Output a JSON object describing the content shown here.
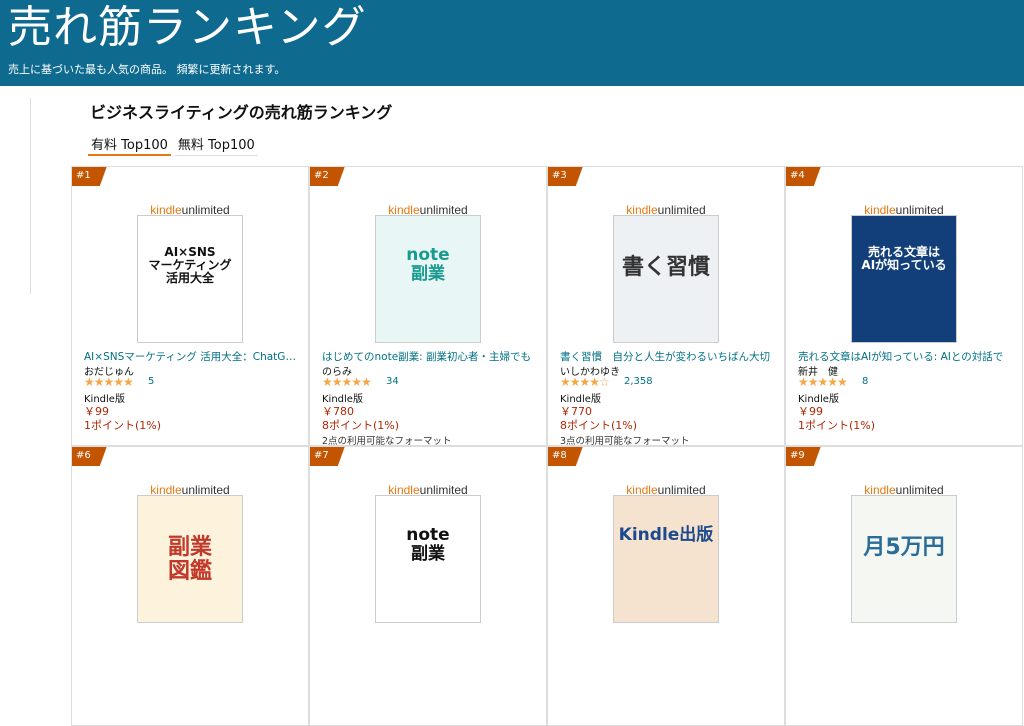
{
  "header": {
    "title": "売れ筋ランキング",
    "subtitle": "売上に基づいた最も人気の商品。 頻繁に更新されます。"
  },
  "category_title": "ビジネスライティングの売れ筋ランキング",
  "tabs": [
    {
      "label": "有料 Top100",
      "active": true
    },
    {
      "label": "無料 Top100",
      "active": false
    }
  ],
  "colors": {
    "banner": "#0f6a8f",
    "rank_badge": "#c45500",
    "link": "#007185",
    "price": "#b12704",
    "star": "#f3a847"
  },
  "kindle_unlimited": {
    "kindle": "kindle",
    "unlimited": "unlimited"
  },
  "products": [
    {
      "rank": "#1",
      "title": "AI×SNSマーケティング 活用大全：ChatGPT",
      "author": "おだじゅん",
      "stars": "★★★★★",
      "reviews": "5",
      "format": "Kindle版",
      "price": "￥99",
      "points": "1ポイント(1%)",
      "availability": "",
      "cover_text": "AI×SNS\nマーケティング\n活用大全",
      "cover_bg": "#ffffff",
      "cover_fg": "#111111"
    },
    {
      "rank": "#2",
      "title": "はじめてのnote副業: 副業初心者・主婦でも",
      "author": "のらみ",
      "stars": "★★★★★",
      "reviews": "34",
      "format": "Kindle版",
      "price": "￥780",
      "points": "8ポイント(1%)",
      "availability": "2点の利用可能なフォーマット",
      "cover_text": "note\n副業",
      "cover_bg": "#e8f7f6",
      "cover_fg": "#1a9b8f"
    },
    {
      "rank": "#3",
      "title": "書く習慣　自分と人生が変わるいちばん大切",
      "author": "いしかわゆき",
      "stars": "★★★★☆",
      "reviews": "2,358",
      "format": "Kindle版",
      "price": "￥770",
      "points": "8ポイント(1%)",
      "availability": "3点の利用可能なフォーマット",
      "cover_text": "書く習慣",
      "cover_bg": "#eef1f4",
      "cover_fg": "#333333"
    },
    {
      "rank": "#4",
      "title": "売れる文章はAIが知っている: AIとの対話で",
      "author": "新井　健",
      "stars": "★★★★★",
      "reviews": "8",
      "format": "Kindle版",
      "price": "￥99",
      "points": "1ポイント(1%)",
      "availability": "",
      "cover_text": "売れる文章は\nAIが知っている",
      "cover_bg": "#123f7a",
      "cover_fg": "#ffffff"
    },
    {
      "rank": "#6",
      "title": "",
      "author": "",
      "stars": "",
      "reviews": "",
      "format": "",
      "price": "",
      "points": "",
      "availability": "",
      "cover_text": "副業\n図鑑",
      "cover_bg": "#fdf3dd",
      "cover_fg": "#c0392b"
    },
    {
      "rank": "#7",
      "title": "",
      "author": "",
      "stars": "",
      "reviews": "",
      "format": "",
      "price": "",
      "points": "",
      "availability": "",
      "cover_text": "note\n副業",
      "cover_bg": "#ffffff",
      "cover_fg": "#111111"
    },
    {
      "rank": "#8",
      "title": "",
      "author": "",
      "stars": "",
      "reviews": "",
      "format": "",
      "price": "",
      "points": "",
      "availability": "",
      "cover_text": "Kindle出版",
      "cover_bg": "#f6e3cf",
      "cover_fg": "#1d4a8c"
    },
    {
      "rank": "#9",
      "title": "",
      "author": "",
      "stars": "",
      "reviews": "",
      "format": "",
      "price": "",
      "points": "",
      "availability": "",
      "cover_text": "月5万円",
      "cover_bg": "#f4f7f2",
      "cover_fg": "#2b6d99"
    }
  ]
}
